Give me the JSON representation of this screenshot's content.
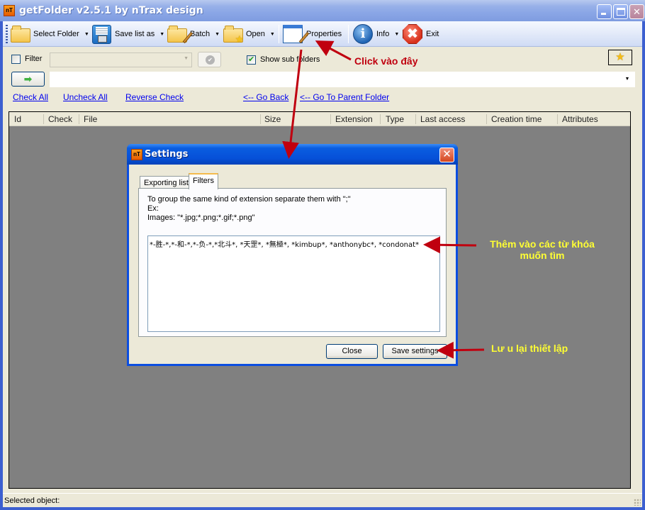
{
  "window": {
    "title": "getFolder v2.5.1 by nTrax design",
    "app_icon_text": "nT",
    "controls": {
      "minimize": "minimize",
      "maximize": "maximize",
      "close": "✕"
    }
  },
  "toolbar": {
    "items": [
      {
        "label": "Select Folder",
        "icon": "folder-icon",
        "has_dropdown": true
      },
      {
        "label": "Save list as",
        "icon": "floppy-disk-icon",
        "has_dropdown": true
      },
      {
        "label": "Batch",
        "icon": "folder-edit-icon",
        "has_dropdown": true
      },
      {
        "label": "Open",
        "icon": "folder-star-icon",
        "has_dropdown": true
      },
      {
        "label": "Properties",
        "icon": "properties-icon",
        "has_dropdown": false
      },
      {
        "label": "Info",
        "icon": "info-icon",
        "has_dropdown": true
      },
      {
        "label": "Exit",
        "icon": "exit-icon",
        "has_dropdown": false
      }
    ],
    "caret": "▼",
    "info_glyph": "i",
    "exit_glyph": "✖"
  },
  "filter_row": {
    "filter_label": "Filter",
    "filter_checked": false,
    "filter_combo_value": "",
    "show_sub_folders_label": "Show sub folders",
    "show_sub_folders_checked": true,
    "ok_glyph": "✔",
    "favorites_glyph": "★"
  },
  "path_row": {
    "go_glyph": "➡",
    "path_value": "",
    "dropdown_glyph": "▼"
  },
  "links": {
    "check_all": "Check All",
    "uncheck_all": "Uncheck All",
    "reverse_check": "Reverse Check",
    "go_back": "<-- Go Back",
    "go_parent": "<-- Go To Parent Folder"
  },
  "file_list": {
    "columns": [
      "Id",
      "Check",
      "File",
      "Size",
      "Extension",
      "Type",
      "Last access",
      "Creation time",
      "Attributes"
    ],
    "rows": []
  },
  "status_bar": {
    "text": "Selected object:"
  },
  "settings_dialog": {
    "title": "Settings",
    "icon_text": "nT",
    "close_glyph": "✕",
    "tabs": [
      {
        "label": "Exporting list",
        "active": false
      },
      {
        "label": "Filters",
        "active": true
      }
    ],
    "help_text": "To group the same kind of extension separate them with \";\"\nEx:\nImages: \"*.jpg;*.png;*.gif;*.png\"",
    "filters_value": "*-胜-*,*-和-*,*-负-*,*北斗*, *天罡*, *無極*, *kimbup*, *anthonybc*, *condonat*",
    "buttons": {
      "close": "Close",
      "save": "Save settings"
    }
  },
  "annotations": {
    "click_here": "Click vào đây",
    "add_keywords_line1": "Thêm vào các từ khóa",
    "add_keywords_line2": "muốn tìm",
    "save_settings": "Lư u lại thiết lập",
    "arrow_color": "#c0000f",
    "note_color": "#ffff33"
  }
}
